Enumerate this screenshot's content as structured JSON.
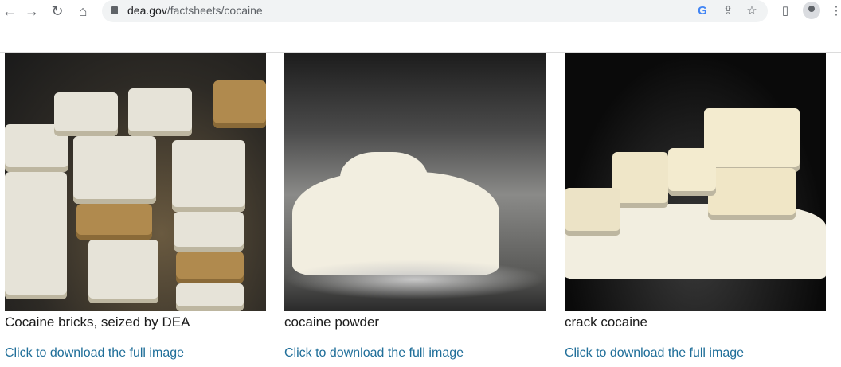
{
  "browser": {
    "url_domain": "dea.gov",
    "url_path": "/factsheets/cocaine"
  },
  "images": [
    {
      "caption": "Cocaine bricks, seized by DEA",
      "link": "Click to download the full image"
    },
    {
      "caption": "cocaine powder",
      "link": "Click to download the full image"
    },
    {
      "caption": "crack cocaine",
      "link": "Click to download the full image"
    }
  ],
  "colors": {
    "link": "#1f6e99",
    "omnibox": "#f1f3f4"
  }
}
